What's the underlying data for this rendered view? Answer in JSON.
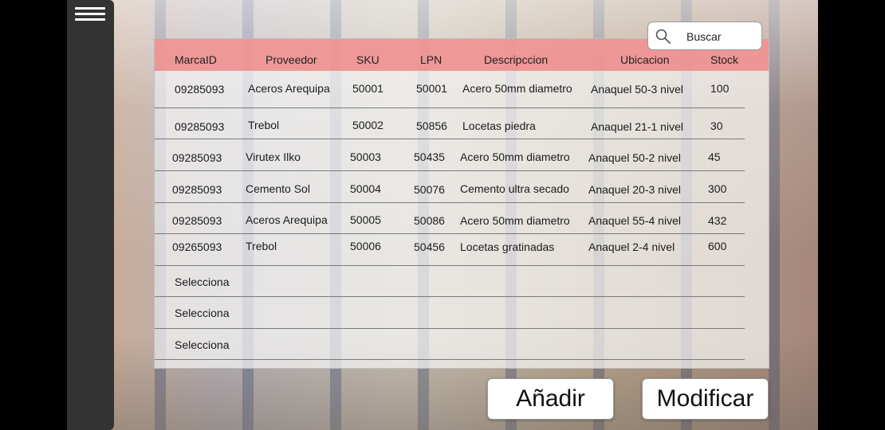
{
  "search": {
    "placeholder": "Buscar"
  },
  "table": {
    "headers": [
      "MarcaID",
      "Proveedor",
      "SKU",
      "LPN",
      "Descripccion",
      "Ubicacion",
      "Stock"
    ],
    "rows": [
      [
        "09285093",
        "Aceros Arequipa",
        "50001",
        "50001",
        "Acero 50mm diametro",
        "Anaquel 50-3 nivel",
        "100"
      ],
      [
        "09285093",
        "Trebol",
        "50002",
        "50856",
        "Locetas piedra",
        "Anaquel 21-1 nivel",
        "30"
      ],
      [
        "09285093",
        "Virutex Ilko",
        "50003",
        "50435",
        "Acero 50mm diametro",
        "Anaquel 50-2 nivel",
        "45"
      ],
      [
        "09285093",
        "Cemento Sol",
        "50004",
        "50076",
        "Cemento ultra secado",
        "Anaquel 20-3 nivel",
        "300"
      ],
      [
        "09285093",
        "Aceros Arequipa",
        "50005",
        "50086",
        "Acero 50mm diametro",
        "Anaquel 55-4 nivel",
        "432"
      ],
      [
        "09265093",
        "Trebol",
        "50006",
        "50456",
        "Locetas gratinadas",
        "Anaquel 2-4 nivel",
        "600"
      ]
    ],
    "empty_rows": [
      "Selecciona",
      "Selecciona",
      "Selecciona"
    ]
  },
  "buttons": {
    "add": "Añadir",
    "modify": "Modificar"
  },
  "icons": {
    "menu": "hamburger-menu-icon",
    "search": "search-icon"
  },
  "colors": {
    "header": "#ee8080",
    "sidebar": "#333333"
  }
}
